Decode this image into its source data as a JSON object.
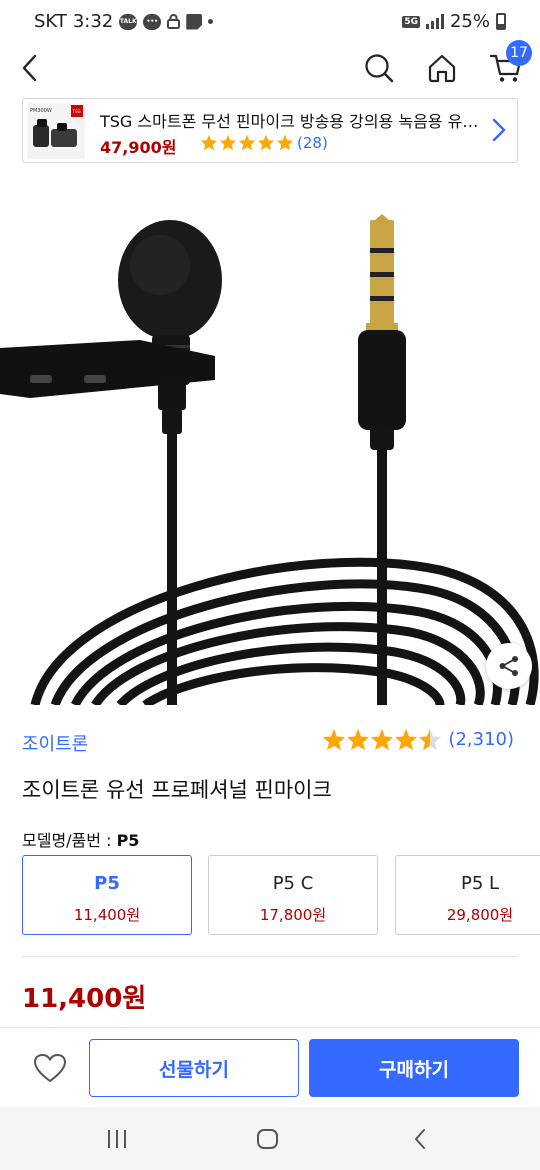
{
  "status_bar": {
    "carrier": "SKT",
    "time": "3:32",
    "talk_badge": "TALK",
    "network": "5G",
    "battery": "25%"
  },
  "nav": {
    "cart_count": "17",
    "icons": [
      "back-icon",
      "search-icon",
      "home-icon",
      "cart-icon"
    ]
  },
  "related": {
    "thumb_model": "PM300W",
    "thumb_brand": "TSG",
    "title": "TSG 스마트폰 무선 핀마이크 방송용 강의용 녹음용 유튜브",
    "price": "47,900원",
    "rating_value": 5,
    "review_count": "(28)"
  },
  "product": {
    "brand": "조이트론",
    "rating_value": 4.5,
    "review_count": "(2,310)",
    "title": "조이트론 유선 프로페셔널 핀마이크",
    "model_label": "모델명/품번 : ",
    "model_value": "P5",
    "options": [
      {
        "name": "P5",
        "price": "11,400원",
        "selected": true
      },
      {
        "name": "P5 C",
        "price": "17,800원",
        "selected": false
      },
      {
        "name": "P5 L",
        "price": "29,800원",
        "selected": false
      }
    ],
    "final_price": "11,400원"
  },
  "actions": {
    "gift_label": "선물하기",
    "buy_label": "구매하기"
  },
  "colors": {
    "accent": "#346aff",
    "price_red": "#ae0000",
    "star": "#ffa800"
  }
}
